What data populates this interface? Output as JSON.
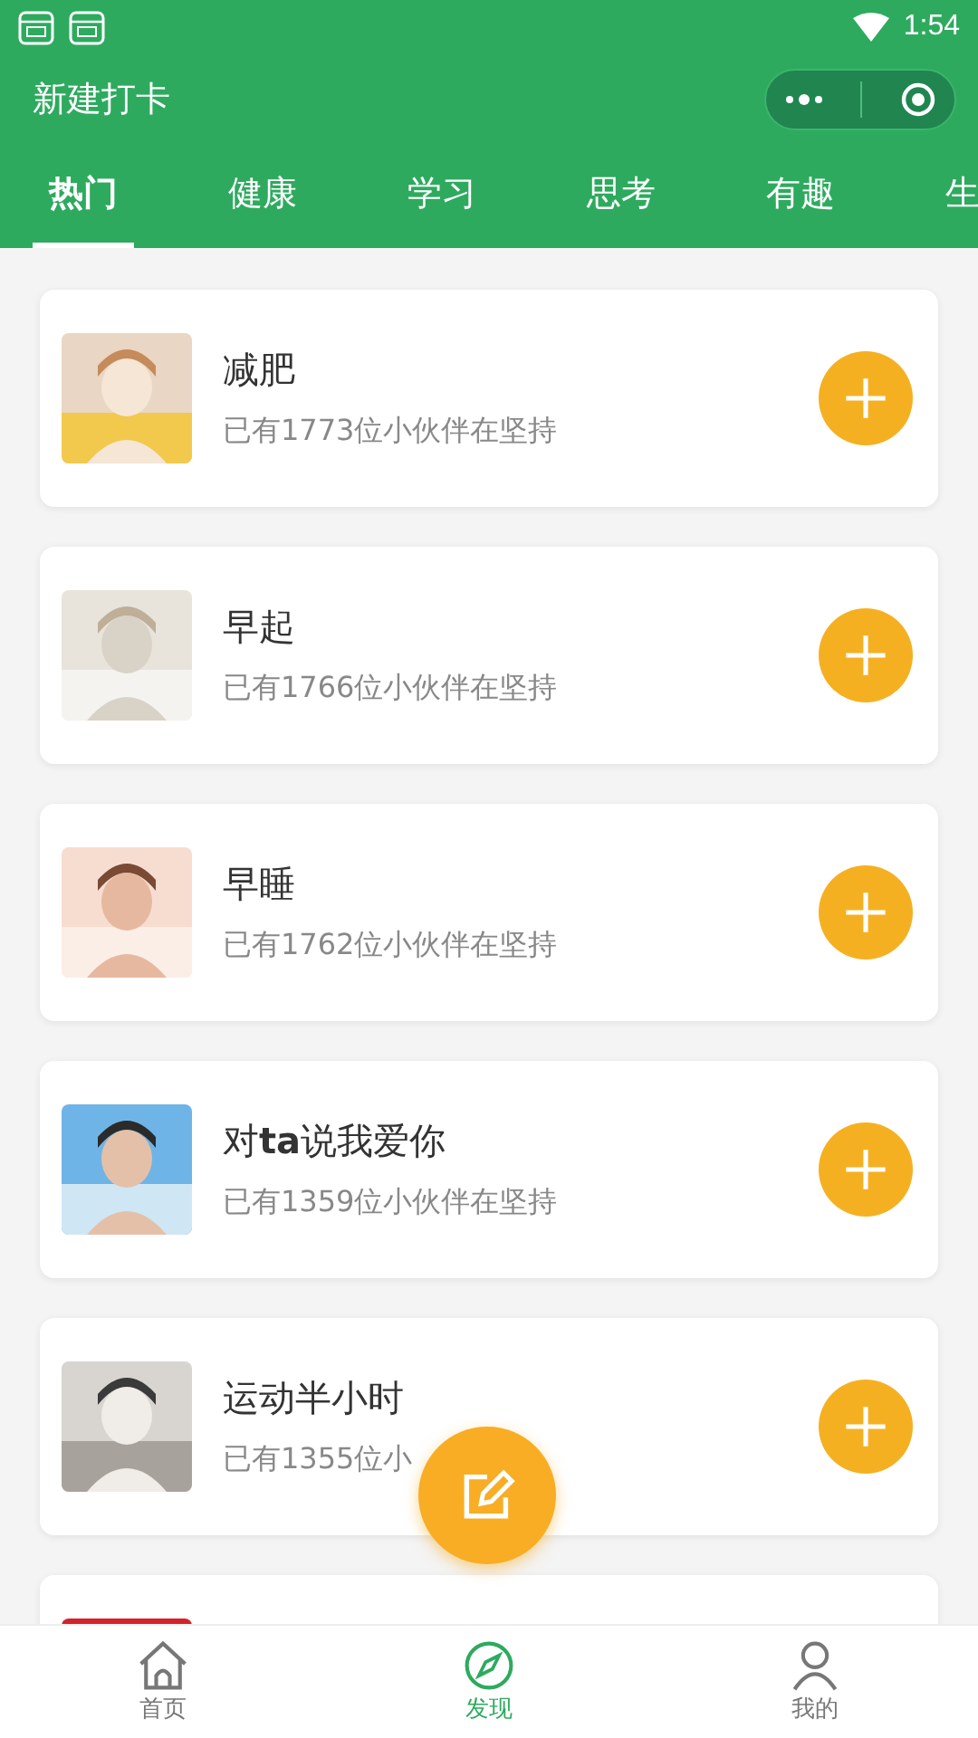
{
  "status_bar": {
    "time": "1:54"
  },
  "header": {
    "title": "新建打卡"
  },
  "tabs": [
    {
      "label": "热门",
      "selected": true
    },
    {
      "label": "健康",
      "selected": false
    },
    {
      "label": "学习",
      "selected": false
    },
    {
      "label": "思考",
      "selected": false
    },
    {
      "label": "有趣",
      "selected": false
    },
    {
      "label": "生",
      "selected": false
    }
  ],
  "habits": [
    {
      "title": "减肥",
      "subtitle": "已有1773位小伙伴在坚持",
      "picture": {
        "kind": "picture"
      }
    },
    {
      "title": "早起",
      "subtitle": "已有1766位小伙伴在坚持",
      "picture": {
        "kind": "picture"
      }
    },
    {
      "title": "早睡",
      "subtitle": "已有1762位小伙伴在坚持",
      "picture": {
        "kind": "picture"
      }
    },
    {
      "title": "对**ta**说我爱你",
      "subtitle": "已有1359位小伙伴在坚持",
      "picture": {
        "kind": "picture"
      }
    },
    {
      "title": "运动半小时",
      "subtitle": "已有1355位小",
      "picture": {
        "kind": "picture"
      }
    },
    {
      "picture": {
        "kind": "picture"
      }
    }
  ],
  "bottom_nav": [
    {
      "label": "首页",
      "selected": false
    },
    {
      "label": "发现",
      "selected": true
    },
    {
      "label": "我的",
      "selected": false
    }
  ]
}
